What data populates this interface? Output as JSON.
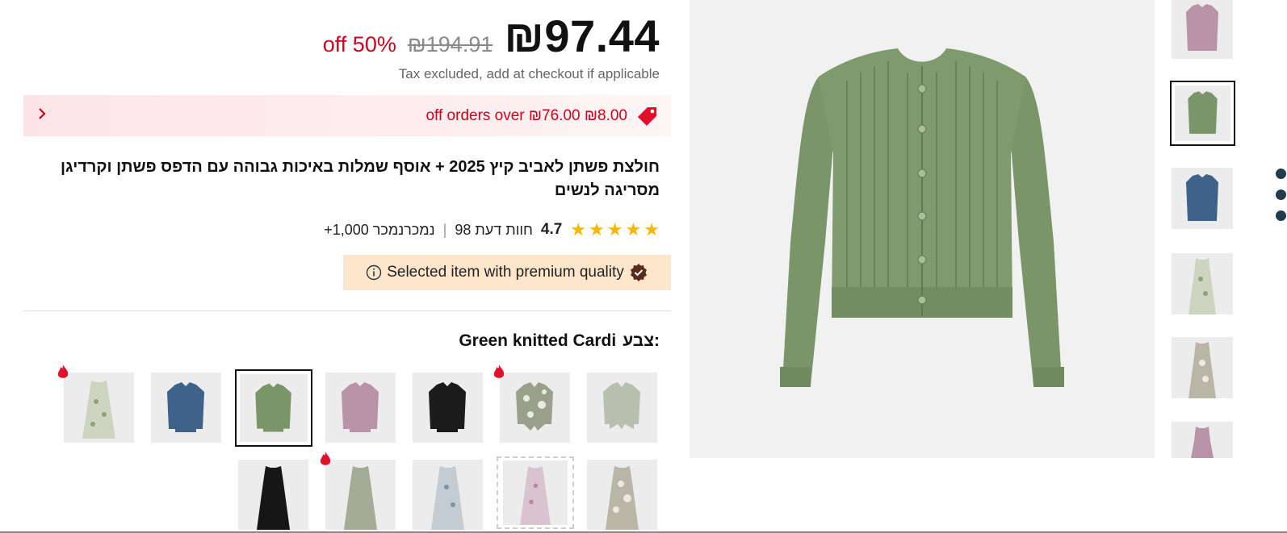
{
  "price": {
    "current": "₪97.44",
    "original": "₪194.91",
    "discount": "off 50%",
    "tax_note": "Tax excluded, add at checkout if applicable"
  },
  "coupon": {
    "text": "off orders over ₪76.00 ₪8.00",
    "icon": "tag-icon",
    "chevron": "chevron-left-icon",
    "color": "#d0011b"
  },
  "product": {
    "title": "חולצת פשתן לאביב קיץ 2025 + אוסף שמלות באיכות גבוהה עם הדפס פשתן וקרדיגן מסריגה לנשים"
  },
  "rating": {
    "stars": 5,
    "value": "4.7",
    "reviews": "98 חוות דעת",
    "separator": "|",
    "sold": "+1,000 נמכרנמכר"
  },
  "premium": {
    "text": "Selected item with premium quality",
    "bg_color": "#fde6cc"
  },
  "color_selector": {
    "label": "צבע:",
    "value": "Green knitted Cardi"
  },
  "swatches": [
    {
      "name": "green-shirt",
      "hot": false,
      "selected": false
    },
    {
      "name": "floral-shirt",
      "hot": true,
      "selected": false
    },
    {
      "name": "black-cardigan",
      "hot": false,
      "selected": false
    },
    {
      "name": "pink-cardigan",
      "hot": false,
      "selected": false
    },
    {
      "name": "green-cardigan",
      "hot": false,
      "selected": true
    },
    {
      "name": "blue-cardigan",
      "hot": false,
      "selected": false
    },
    {
      "name": "floral-dress-green",
      "hot": true,
      "selected": false
    },
    {
      "name": "floral-dress-print",
      "hot": false,
      "selected": false
    },
    {
      "name": "pink-floral-dress",
      "hot": false,
      "selected": false
    },
    {
      "name": "blue-floral-dress",
      "hot": false,
      "selected": false
    },
    {
      "name": "sage-dress",
      "hot": true,
      "selected": false
    },
    {
      "name": "black-dress",
      "hot": false,
      "selected": false
    }
  ],
  "gallery": {
    "main_image": "green-knitted-cardigan",
    "thumbnails": [
      "pink-cardigan",
      "green-cardigan",
      "blue-cardigan",
      "floral-dress-green",
      "floral-dress-print",
      "pink-floral-dress"
    ],
    "selected_thumbnail": 1
  },
  "colors": {
    "accent": "#d0011b",
    "star": "#f5b800",
    "cardigan_green": "#7a9668"
  }
}
